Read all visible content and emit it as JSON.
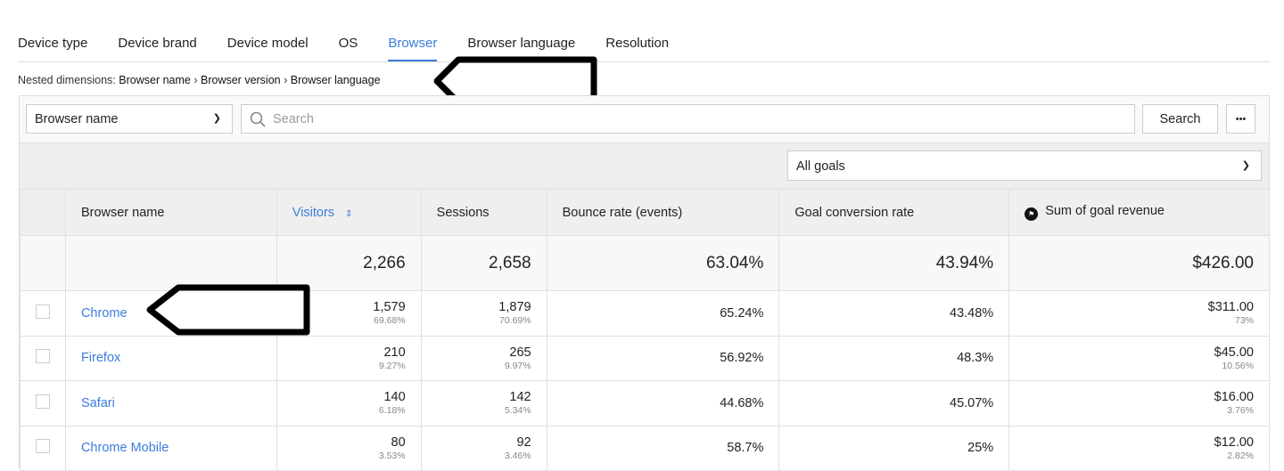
{
  "tabs": [
    {
      "label": "Device type"
    },
    {
      "label": "Device brand"
    },
    {
      "label": "Device model"
    },
    {
      "label": "OS"
    },
    {
      "label": "Browser",
      "active": true
    },
    {
      "label": "Browser language"
    },
    {
      "label": "Resolution"
    }
  ],
  "nested": {
    "label": "Nested dimensions:",
    "path": [
      "Browser name",
      "Browser version",
      "Browser language"
    ],
    "separator": "›"
  },
  "toolbar": {
    "dimension": "Browser name",
    "search_placeholder": "Search",
    "search_label": "Search",
    "more_label": "•••"
  },
  "goals": {
    "selected": "All goals"
  },
  "table": {
    "headers": [
      "Browser name",
      "Visitors",
      "Sessions",
      "Bounce rate (events)",
      "Goal conversion rate",
      "Sum of goal revenue"
    ],
    "sorted_column": "Visitors",
    "totals": [
      "2,266",
      "2,658",
      "63.04%",
      "43.94%",
      "$426.00"
    ],
    "rows": [
      {
        "name": "Chrome",
        "visitors": "1,579",
        "visitors_pct": "69.68%",
        "sessions": "1,879",
        "sessions_pct": "70.69%",
        "bounce": "65.24%",
        "conv": "43.48%",
        "revenue": "$311.00",
        "revenue_pct": "73%"
      },
      {
        "name": "Firefox",
        "visitors": "210",
        "visitors_pct": "9.27%",
        "sessions": "265",
        "sessions_pct": "9.97%",
        "bounce": "56.92%",
        "conv": "48.3%",
        "revenue": "$45.00",
        "revenue_pct": "10.56%"
      },
      {
        "name": "Safari",
        "visitors": "140",
        "visitors_pct": "6.18%",
        "sessions": "142",
        "sessions_pct": "5.34%",
        "bounce": "44.68%",
        "conv": "45.07%",
        "revenue": "$16.00",
        "revenue_pct": "3.76%"
      },
      {
        "name": "Chrome Mobile",
        "visitors": "80",
        "visitors_pct": "3.53%",
        "sessions": "92",
        "sessions_pct": "3.46%",
        "bounce": "58.7%",
        "conv": "25%",
        "revenue": "$12.00",
        "revenue_pct": "2.82%"
      }
    ]
  },
  "colors": {
    "accent": "#3b7ddd"
  }
}
